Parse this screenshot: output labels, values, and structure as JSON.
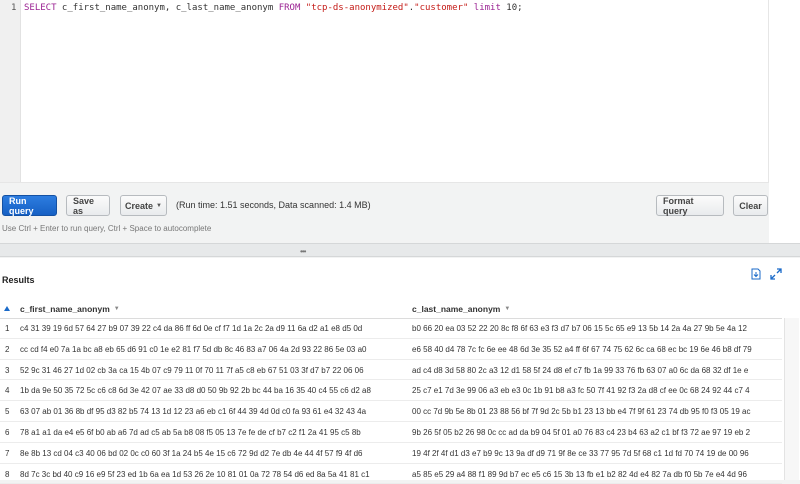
{
  "editor": {
    "line_number": "1",
    "tokens": {
      "select": "SELECT",
      "columns": " c_first_name_anonym, c_last_name_anonym ",
      "from": "FROM",
      "db": "\"tcp-ds-anonymized\"",
      "dot": ".",
      "table": "\"customer\"",
      "limit": "limit",
      "rest": " 10;"
    }
  },
  "toolbar": {
    "run_query": "Run query",
    "save_as": "Save as",
    "create": "Create",
    "run_info": "(Run time: 1.51 seconds, Data scanned: 1.4 MB)",
    "format_query": "Format query",
    "clear": "Clear",
    "hint": "Use Ctrl + Enter to run query, Ctrl + Space to autocomplete"
  },
  "results": {
    "title": "Results",
    "columns": [
      "c_first_name_anonym",
      "c_last_name_anonym"
    ],
    "rows": [
      {
        "idx": "1",
        "a": "c4 31 39 19 6d 57 64 27 b9 07 39 22 c4 da 86 ff 6d 0e cf f7 1d 1a 2c 2a d9 11 6a d2 a1 e8 d5 0d",
        "b": "b0 66 20 ea 03 52 22 20 8c f8 6f 63 e3 f3 d7 b7 06 15 5c 65 e9 13 5b 14 2a 4a 27 9b 5e 4a 12"
      },
      {
        "idx": "2",
        "a": "cc cd f4 e0 7a 1a bc a8 eb 65 d6 91 c0 1e e2 81 f7 5d db 8c 46 83 a7 06 4a 2d 93 22 86 5e 03 a0",
        "b": "e6 58 40 d4 78 7c fc 6e ee 48 6d 3e 35 52 a4 ff 6f 67 74 75 62 6c ca 68 ec bc 19 6e 46 b8 df 79"
      },
      {
        "idx": "3",
        "a": "52 9c 31 46 27 1d 02 cb 3a ca 15 4b 07 c9 79 11 0f 70 11 7f a5 c8 eb 67 51 03 3f d7 b7 22 06 06",
        "b": "ad c4 d8 3d 58 80 2c a3 12 d1 58 5f 24 d8 ef c7 fb 1a 99 33 76 fb 63 07 a0 6c da 68 32 df 1e e"
      },
      {
        "idx": "4",
        "a": "1b da 9e 50 35 72 5c c6 c8 6d 3e 42 07 ae 33 d8 d0 50 9b 92 2b bc 44 ba 16 35 40 c4 55 c6 d2 a8",
        "b": "25 c7 e1 7d 3e 99 06 a3 eb e3 0c 1b 91 b8 a3 fc 50 7f 41 92 f3 2a d8 cf ee 0c 68 24 92 44 c7 4"
      },
      {
        "idx": "5",
        "a": "63 07 ab 01 36 8b df 95 d3 82 b5 74 13 1d 12 23 a6 eb c1 6f 44 39 4d 0d c0 fa 93 61 e4 32 43 4a",
        "b": "00 cc 7d 9b 5e 8b 01 23 88 56 bf 7f 9d 2c 5b b1 23 13 bb e4 7f 9f 61 23 74 db 95 f0 f3 05 19 ac"
      },
      {
        "idx": "6",
        "a": "78 a1 a1 da e4 e5 6f b0 ab a6 7d ad c5 ab 5a b8 08 f5 05 13 7e fe de cf b7 c2 f1 2a 41 95 c5 8b",
        "b": "9b 26 5f 05 b2 26 98 0c cc ad da b9 04 5f 01 a0 76 83 c4 23 b4 63 a2 c1 bf f3 72 ae 97 19 eb 2"
      },
      {
        "idx": "7",
        "a": "8e 8b 13 cd 04 c3 40 06 bd 02 0c c0 60 3f 1a 24 b5 4e 15 c6 72 9d d2 7e db 4e 44 4f 57 f9 4f d6",
        "b": "19 4f 2f 4f d1 d3 e7 b9 9c 13 9a df d9 71 9f 8e ce 33 77 95 7d 5f 68 c1 1d fd 70 74 19 de 00 96"
      },
      {
        "idx": "8",
        "a": "8d 7c 3c bd 40 c9 16 e9 5f 23 ed 1b 6a ea 1d 53 26 2e 10 81 01 0a 72 78 54 d6 ed 8a 5a 41 81 c1",
        "b": "a5 85 e5 29 a4 88 f1 89 9d b7 ec e5 c6 15 3b 13 fb e1 b2 82 4d e4 82 7a db f0 5b 7e e4 4d 96"
      }
    ]
  }
}
